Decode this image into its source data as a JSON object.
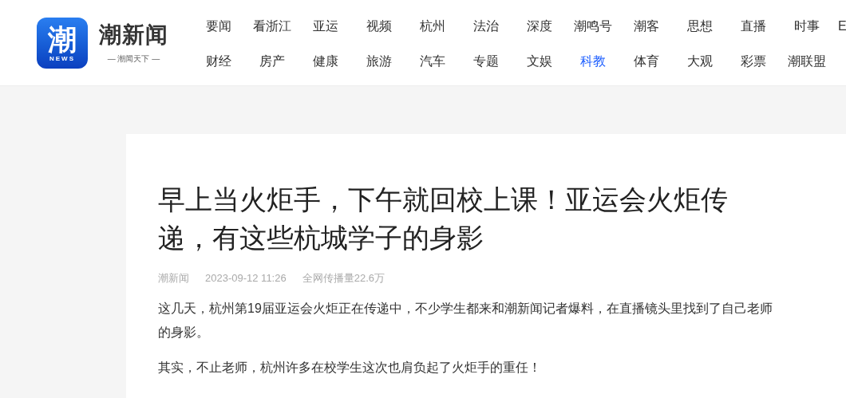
{
  "logo": {
    "glyph": "潮",
    "badge": "NEWS",
    "name": "潮新闻",
    "slogan": "— 潮闻天下 —"
  },
  "nav": [
    [
      {
        "label": "要闻",
        "selected": false
      },
      {
        "label": "看浙江",
        "selected": false
      },
      {
        "label": "亚运",
        "selected": false
      },
      {
        "label": "视频",
        "selected": false
      },
      {
        "label": "杭州",
        "selected": false
      },
      {
        "label": "法治",
        "selected": false
      },
      {
        "label": "深度",
        "selected": false
      },
      {
        "label": "潮鸣号",
        "selected": false
      },
      {
        "label": "潮客",
        "selected": false
      },
      {
        "label": "思想",
        "selected": false
      },
      {
        "label": "直播",
        "selected": false
      },
      {
        "label": "时事",
        "selected": false
      },
      {
        "label": "E",
        "selected": false
      }
    ],
    [
      {
        "label": "财经",
        "selected": false
      },
      {
        "label": "房产",
        "selected": false
      },
      {
        "label": "健康",
        "selected": false
      },
      {
        "label": "旅游",
        "selected": false
      },
      {
        "label": "汽车",
        "selected": false
      },
      {
        "label": "专题",
        "selected": false
      },
      {
        "label": "文娱",
        "selected": false
      },
      {
        "label": "科教",
        "selected": true
      },
      {
        "label": "体育",
        "selected": false
      },
      {
        "label": "大观",
        "selected": false
      },
      {
        "label": "彩票",
        "selected": false
      },
      {
        "label": "潮联盟",
        "selected": false
      }
    ]
  ],
  "article": {
    "title": "早上当火炬手，下午就回校上课！亚运会火炬传递，有这些杭城学子的身影",
    "source": "潮新闻",
    "time": "2023-09-12 11:26",
    "reach": "全网传播量22.6万",
    "paragraphs": [
      "这几天，杭州第19届亚运会火炬正在传递中，不少学生都来和潮新闻记者爆料，在直播镜头里找到了自己老师的身影。",
      "其实，不止老师，杭州许多在校学生这次也肩负起了火炬手的重任！"
    ]
  }
}
